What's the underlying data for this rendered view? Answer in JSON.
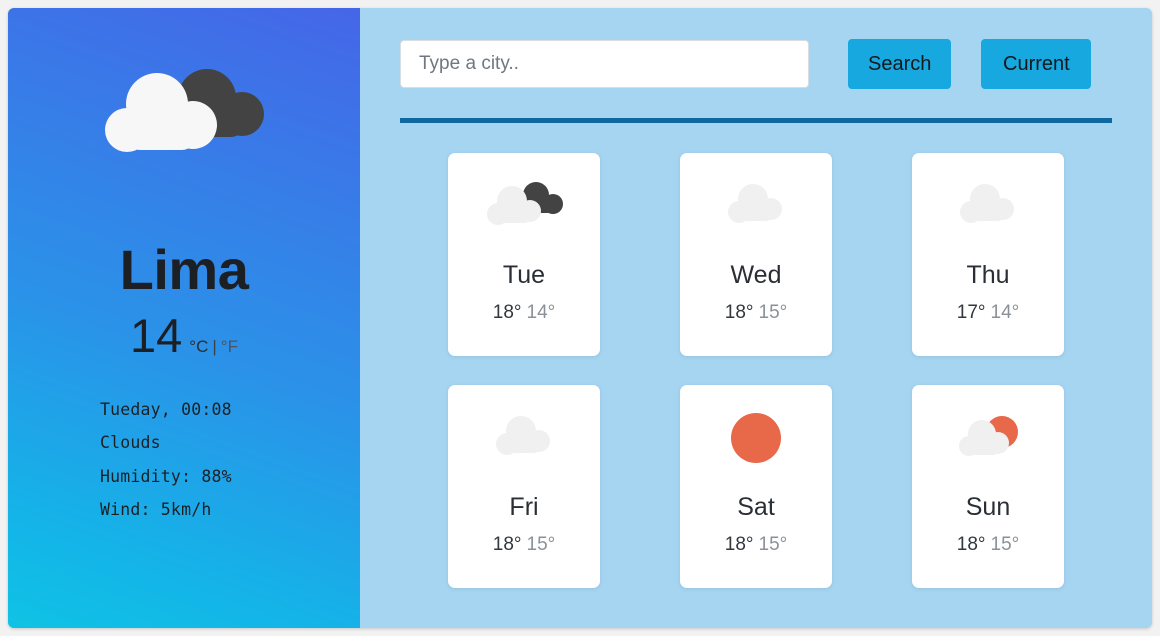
{
  "colors": {
    "left_gradient_start": "#4566e8",
    "left_gradient_end": "#0fc3e4",
    "right_bg": "#a6d5f2",
    "button": "#17a8df",
    "divider": "#1068a0",
    "card_bg": "#ffffff",
    "cloud_light": "#f2f2f2",
    "cloud_dark": "#434343",
    "sun": "#e8694a"
  },
  "current": {
    "icon": "clouds-overcast-icon",
    "city": "Lima",
    "temperature": "14",
    "unit_celsius": "°C",
    "unit_separator": "|",
    "unit_fahrenheit": "°F",
    "active_unit": "°C",
    "details": {
      "datetime": "Tueday, 00:08",
      "condition": "Clouds",
      "humidity": "Humidity: 88%",
      "wind": "Wind: 5km/h"
    }
  },
  "search": {
    "placeholder": "Type a city..",
    "value": "",
    "search_label": "Search",
    "current_label": "Current"
  },
  "forecast": [
    {
      "day": "Tue",
      "high": "18°",
      "low": "14°",
      "icon": "clouds-overcast-icon"
    },
    {
      "day": "Wed",
      "high": "18°",
      "low": "15°",
      "icon": "cloud-icon"
    },
    {
      "day": "Thu",
      "high": "17°",
      "low": "14°",
      "icon": "cloud-icon"
    },
    {
      "day": "Fri",
      "high": "18°",
      "low": "15°",
      "icon": "cloud-icon"
    },
    {
      "day": "Sat",
      "high": "18°",
      "low": "15°",
      "icon": "sun-icon"
    },
    {
      "day": "Sun",
      "high": "18°",
      "low": "15°",
      "icon": "sun-behind-cloud-icon"
    }
  ]
}
